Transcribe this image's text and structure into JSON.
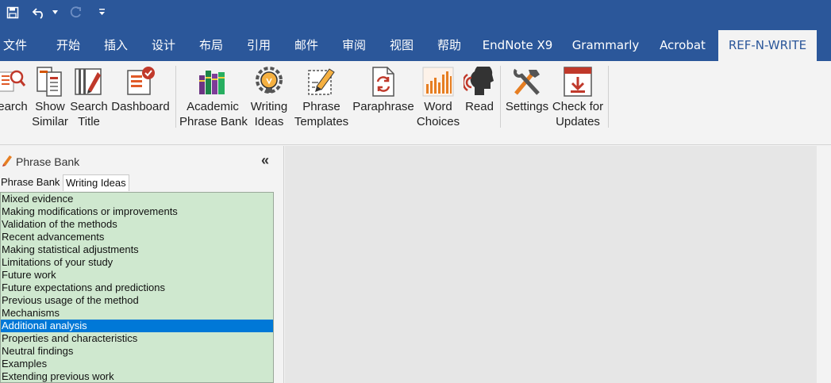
{
  "quick_access": {
    "save_icon": "save-icon",
    "undo_icon": "undo-icon",
    "redo_icon": "redo-icon",
    "customize_icon": "customize-arrow-icon"
  },
  "tabs": [
    {
      "label": "文件"
    },
    {
      "label": "开始"
    },
    {
      "label": "插入"
    },
    {
      "label": "设计"
    },
    {
      "label": "布局"
    },
    {
      "label": "引用"
    },
    {
      "label": "邮件"
    },
    {
      "label": "审阅"
    },
    {
      "label": "视图"
    },
    {
      "label": "帮助"
    },
    {
      "label": "EndNote X9"
    },
    {
      "label": "Grammarly"
    },
    {
      "label": "Acrobat"
    },
    {
      "label": "REF-N-WRITE"
    }
  ],
  "ribbon": {
    "search": {
      "line1": "earch"
    },
    "show_similar": {
      "line1": "Show",
      "line2": "Similar"
    },
    "search_title": {
      "line1": "Search",
      "line2": "Title"
    },
    "dashboard": {
      "line1": "Dashboard"
    },
    "academic_phrase_bank": {
      "line1": "Academic",
      "line2": "Phrase Bank"
    },
    "writing_ideas": {
      "line1": "Writing",
      "line2": "Ideas"
    },
    "phrase_templates": {
      "line1": "Phrase",
      "line2": "Templates"
    },
    "paraphrase": {
      "line1": "Paraphrase"
    },
    "word_choices": {
      "line1": "Word",
      "line2": "Choices"
    },
    "read": {
      "line1": "Read"
    },
    "settings": {
      "line1": "Settings"
    },
    "check_updates": {
      "line1": "Check for",
      "line2": "Updates"
    }
  },
  "pane": {
    "title": "Phrase Bank",
    "collapse": "«",
    "tabs": [
      "Phrase Bank",
      "Writing Ideas"
    ],
    "items": [
      "Mixed evidence",
      "Making modifications or improvements",
      "Validation of the methods",
      "Recent advancements",
      "Making statistical adjustments",
      "Limitations of your study",
      "Future work",
      "Future expectations and predictions",
      "Previous usage of the method",
      "Mechanisms",
      "Additional analysis",
      "Properties and characteristics",
      "Neutral findings",
      "Examples",
      "Extending previous work"
    ],
    "selected_index": 10
  },
  "colors": {
    "brand": "#2b579a",
    "list_bg": "#cfe8cf",
    "selection": "#0078d7"
  }
}
